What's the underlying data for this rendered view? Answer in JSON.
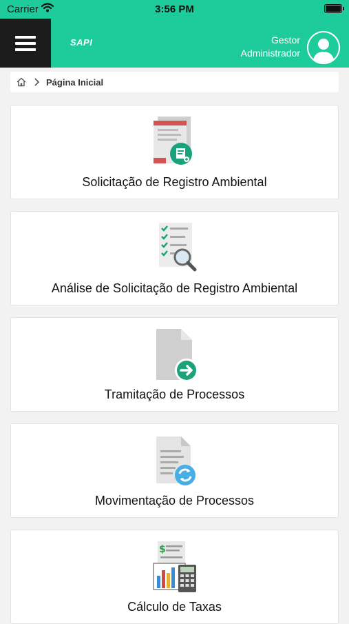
{
  "status_bar": {
    "carrier": "Carrier",
    "time": "3:56 PM"
  },
  "header": {
    "logo": "SAPI",
    "user_line1": "Gestor",
    "user_line2": "Administrador"
  },
  "breadcrumb": {
    "current": "Página Inicial"
  },
  "cards": [
    {
      "label": "Solicitação de Registro Ambiental",
      "icon": "document-add-icon"
    },
    {
      "label": "Análise de Solicitação de Registro Ambiental",
      "icon": "checklist-search-icon"
    },
    {
      "label": "Tramitação de Processos",
      "icon": "document-forward-icon"
    },
    {
      "label": "Movimentação de Processos",
      "icon": "document-refresh-icon"
    },
    {
      "label": "Cálculo de Taxas",
      "icon": "calculator-chart-icon"
    }
  ],
  "colors": {
    "accent": "#1dcc9a",
    "menu_bg": "#1c1c1c"
  }
}
